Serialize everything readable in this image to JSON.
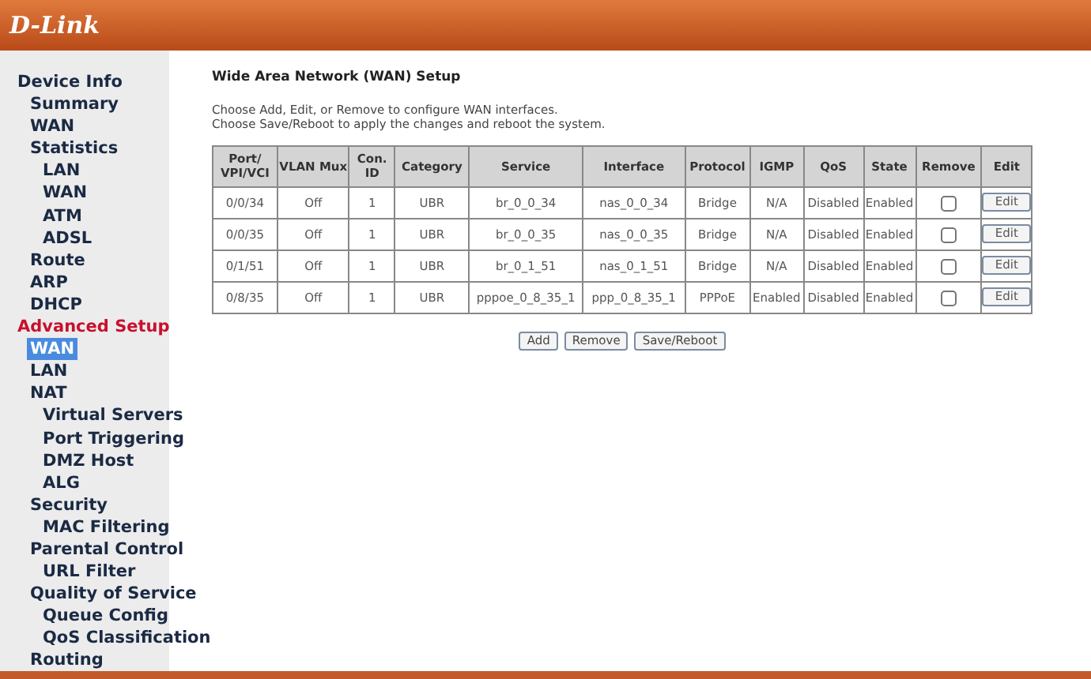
{
  "header": {
    "logo": "D-Link"
  },
  "sidebar": {
    "items": [
      {
        "label": "Device Info",
        "active": false,
        "selected": false,
        "children": [
          {
            "label": "Summary",
            "selected": false
          },
          {
            "label": "WAN",
            "selected": false
          },
          {
            "label": "Statistics",
            "selected": false,
            "children": [
              {
                "label": "LAN",
                "selected": false
              },
              {
                "label": "WAN",
                "selected": false
              },
              {
                "label": "ATM",
                "selected": false
              },
              {
                "label": "ADSL",
                "selected": false
              }
            ]
          },
          {
            "label": "Route",
            "selected": false
          },
          {
            "label": "ARP",
            "selected": false
          },
          {
            "label": "DHCP",
            "selected": false
          }
        ]
      },
      {
        "label": "Advanced Setup",
        "active": true,
        "selected": false,
        "children": [
          {
            "label": "WAN",
            "selected": true
          },
          {
            "label": "LAN",
            "selected": false
          },
          {
            "label": "NAT",
            "selected": false,
            "children": [
              {
                "label": "Virtual Servers",
                "selected": false
              },
              {
                "label": "Port Triggering",
                "selected": false
              },
              {
                "label": "DMZ Host",
                "selected": false
              },
              {
                "label": "ALG",
                "selected": false
              }
            ]
          },
          {
            "label": "Security",
            "selected": false,
            "children": [
              {
                "label": "MAC Filtering",
                "selected": false
              }
            ]
          },
          {
            "label": "Parental Control",
            "selected": false,
            "children": [
              {
                "label": "URL Filter",
                "selected": false
              }
            ]
          },
          {
            "label": "Quality of Service",
            "selected": false,
            "children": [
              {
                "label": "Queue Config",
                "selected": false
              },
              {
                "label": "QoS Classification",
                "selected": false
              }
            ]
          },
          {
            "label": "Routing",
            "selected": false
          }
        ]
      }
    ]
  },
  "main": {
    "title": "Wide Area Network (WAN) Setup",
    "instructions": [
      "Choose Add, Edit, or Remove to configure WAN interfaces.",
      "Choose Save/Reboot to apply the changes and reboot the system."
    ],
    "table": {
      "columns": [
        "Port/ VPI/VCI",
        "VLAN Mux",
        "Con. ID",
        "Category",
        "Service",
        "Interface",
        "Protocol",
        "IGMP",
        "QoS",
        "State",
        "Remove",
        "Edit"
      ],
      "rows": [
        {
          "cells": [
            "0/0/34",
            "Off",
            "1",
            "UBR",
            "br_0_0_34",
            "nas_0_0_34",
            "Bridge",
            "N/A",
            "Disabled",
            "Enabled"
          ],
          "remove": false,
          "edit": "Edit"
        },
        {
          "cells": [
            "0/0/35",
            "Off",
            "1",
            "UBR",
            "br_0_0_35",
            "nas_0_0_35",
            "Bridge",
            "N/A",
            "Disabled",
            "Enabled"
          ],
          "remove": false,
          "edit": "Edit"
        },
        {
          "cells": [
            "0/1/51",
            "Off",
            "1",
            "UBR",
            "br_0_1_51",
            "nas_0_1_51",
            "Bridge",
            "N/A",
            "Disabled",
            "Enabled"
          ],
          "remove": false,
          "edit": "Edit"
        },
        {
          "cells": [
            "0/8/35",
            "Off",
            "1",
            "UBR",
            "pppoe_0_8_35_1",
            "ppp_0_8_35_1",
            "PPPoE",
            "Enabled",
            "Disabled",
            "Enabled"
          ],
          "remove": false,
          "edit": "Edit"
        }
      ]
    },
    "buttons": [
      "Add",
      "Remove",
      "Save/Reboot"
    ]
  }
}
